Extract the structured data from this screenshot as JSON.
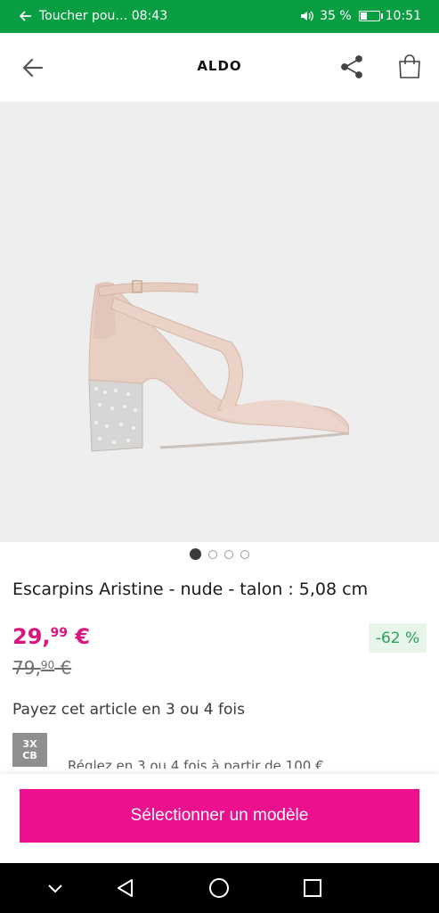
{
  "status_bar": {
    "notification_text": "Toucher pou… 08:43",
    "battery_percent": "35 %",
    "battery_level": 0.35,
    "time": "10:51",
    "back_arrow_icon": "arrow-left-icon",
    "volume_icon": "volume-icon"
  },
  "header": {
    "logo": "ALDO",
    "back_icon": "arrow-left-icon",
    "share_icon": "share-icon",
    "bag_icon": "shopping-bag-icon"
  },
  "product": {
    "image_alt": "Escarpins Aristine nude",
    "carousel": {
      "count": 4,
      "active_index": 0
    },
    "title": "Escarpins Aristine - nude - talon : 5,08 cm",
    "price": {
      "main": "29,",
      "cents": "99",
      "currency": " €"
    },
    "old_price": {
      "main": "79,",
      "cents": "90",
      "currency": " €"
    },
    "discount": "-62 %",
    "installments_title": "Payez cet article en 3 ou 4 fois",
    "cb_badge_line1": "3X",
    "cb_badge_line2": "CB",
    "cb_text": "Réglez en 3 ou 4 fois à partir de 100 €"
  },
  "cta": {
    "label": "Sélectionner un modèle"
  },
  "nav_bar": {
    "icons": [
      "chevron-down-icon",
      "back-triangle-icon",
      "home-circle-icon",
      "recents-square-icon"
    ]
  },
  "colors": {
    "status_green": "#0a9e43",
    "price_pink": "#d9157f",
    "cta_pink": "#ec0f8e",
    "discount_green": "#2aa05a"
  }
}
